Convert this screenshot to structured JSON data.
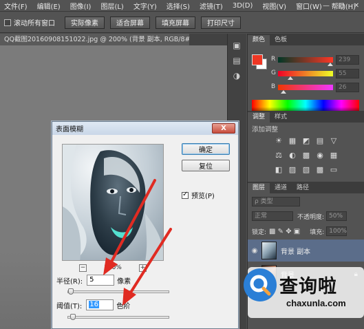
{
  "menu": [
    "文件(F)",
    "编辑(E)",
    "图像(I)",
    "图层(L)",
    "文字(Y)",
    "选择(S)",
    "滤镜(T)",
    "3D(D)",
    "视图(V)",
    "窗口(W)",
    "帮助(H)"
  ],
  "window_controls": [
    "—",
    "□",
    "✕"
  ],
  "options_bar": {
    "scroll_all_windows": "滚动所有窗口",
    "buttons": [
      "实际像素",
      "适合屏幕",
      "填充屏幕",
      "打印尺寸"
    ]
  },
  "document_tab": "QQ截图20160908151022.jpg @ 200% (背景 副本, RGB/8#) *",
  "document_tab_close": "×",
  "color_panel": {
    "tabs": [
      "颜色",
      "色板"
    ],
    "channels": [
      {
        "label": "R",
        "value": "239",
        "fraction": 0.94
      },
      {
        "label": "G",
        "value": "55",
        "fraction": 0.22
      },
      {
        "label": "B",
        "value": "26",
        "fraction": 0.1
      }
    ],
    "foreground": "#ef3724"
  },
  "adjust_panel": {
    "tabs": [
      "调整",
      "样式"
    ],
    "title": "添加调整",
    "icons": [
      [
        "☀",
        "▦",
        "◩",
        "▤",
        "▽"
      ],
      [
        "⚖",
        "◐",
        "▩",
        "◉",
        "▦"
      ],
      [
        "◧",
        "▨",
        "▧",
        "▩",
        "▭"
      ]
    ]
  },
  "layers_panel": {
    "tabs": [
      "图层",
      "通道",
      "路径"
    ],
    "kind_label": "ρ 类型",
    "blend_mode": "正常",
    "opacity_label": "不透明度:",
    "opacity_value": "50%",
    "lock_label": "锁定:",
    "fill_label": "填充:",
    "fill_value": "100%",
    "layers": [
      {
        "name": "背景 副本",
        "selected": true
      },
      {
        "name": "背景",
        "selected": false
      }
    ]
  },
  "dialog": {
    "title": "表面模糊",
    "close": "X",
    "ok": "确定",
    "reset": "复位",
    "preview_label": "预览(P)",
    "zoom": "100%",
    "zoom_minus": "−",
    "zoom_plus": "+",
    "radius_label": "半径(R):",
    "radius_value": "5",
    "radius_unit": "像素",
    "radius_fraction": 0.03,
    "threshold_label": "阈值(T):",
    "threshold_value": "16",
    "threshold_unit": "色阶",
    "threshold_fraction": 0.05
  },
  "watermark": {
    "text": "查询啦",
    "sub": "chaxunla.com"
  }
}
